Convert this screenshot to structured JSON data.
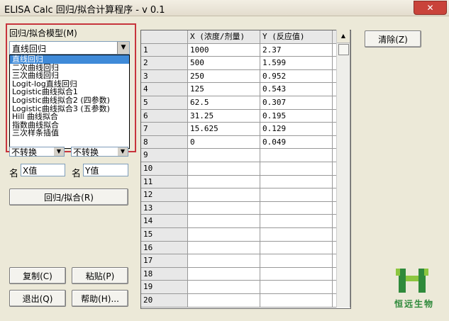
{
  "window": {
    "title": "ELISA Calc 回归/拟合计算程序 - v 0.1",
    "close_glyph": "✕"
  },
  "model": {
    "label": "回归/拟合模型(M)",
    "selected": "直线回归",
    "options": [
      "直线回归",
      "二次曲线回归",
      "三次曲线回归",
      "Logit-log直线回归",
      "Logistic曲线拟合1",
      "Logistic曲线拟合2 (四参数)",
      "Logistic曲线拟合3 (五参数)",
      "Hill 曲线拟合",
      "指数曲线拟合",
      "三次样条插值"
    ]
  },
  "transform": {
    "x": "不转换",
    "y": "不转换"
  },
  "names": {
    "label": "名",
    "x_value": "X值",
    "y_value": "Y值"
  },
  "buttons": {
    "fit": "回归/拟合(R)",
    "copy": "复制(C)",
    "paste": "粘贴(P)",
    "exit": "退出(Q)",
    "help": "帮助(H)...",
    "clear": "清除(Z)"
  },
  "grid": {
    "headers": [
      "",
      "X (浓度/剂量)",
      "Y (反应值)",
      ""
    ],
    "rows": [
      [
        "1",
        "1000",
        "2.37"
      ],
      [
        "2",
        "500",
        "1.599"
      ],
      [
        "3",
        "250",
        "0.952"
      ],
      [
        "4",
        "125",
        "0.543"
      ],
      [
        "5",
        "62.5",
        "0.307"
      ],
      [
        "6",
        "31.25",
        "0.195"
      ],
      [
        "7",
        "15.625",
        "0.129"
      ],
      [
        "8",
        "0",
        "0.049"
      ],
      [
        "9",
        "",
        ""
      ],
      [
        "10",
        "",
        ""
      ],
      [
        "11",
        "",
        ""
      ],
      [
        "12",
        "",
        ""
      ],
      [
        "13",
        "",
        ""
      ],
      [
        "14",
        "",
        ""
      ],
      [
        "15",
        "",
        ""
      ],
      [
        "16",
        "",
        ""
      ],
      [
        "17",
        "",
        ""
      ],
      [
        "18",
        "",
        ""
      ],
      [
        "19",
        "",
        ""
      ],
      [
        "20",
        "",
        ""
      ]
    ]
  },
  "watermark": {
    "text": "恒远生物",
    "color": "#2f8a3b"
  }
}
